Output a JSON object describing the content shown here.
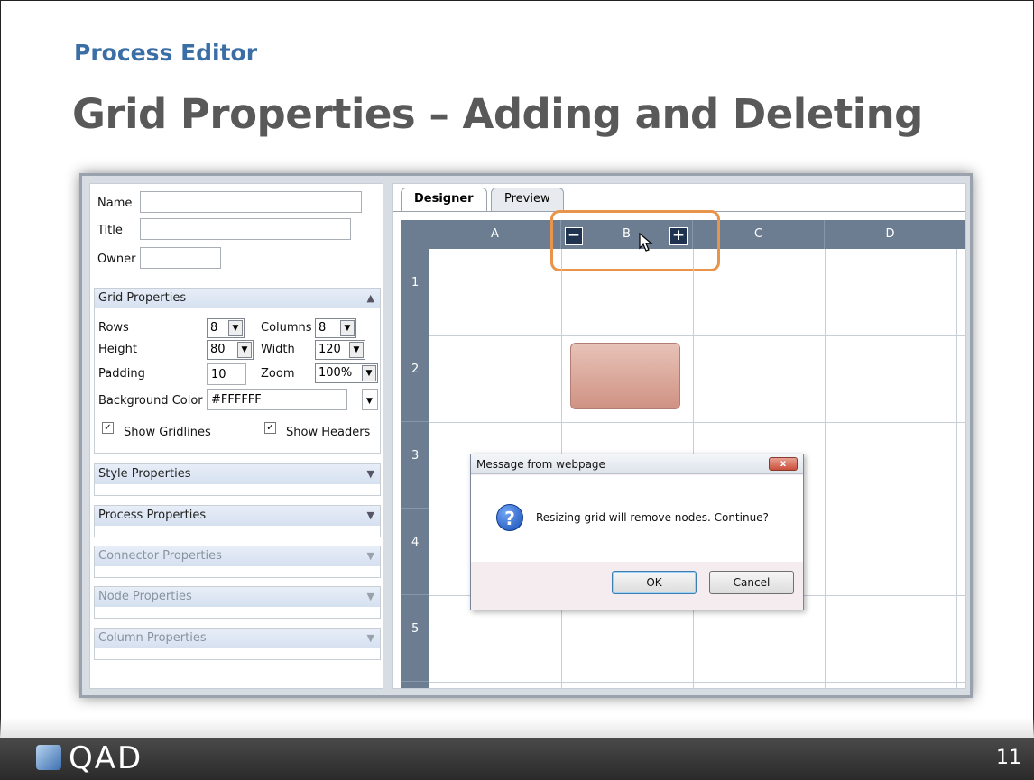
{
  "slide": {
    "subtitle": "Process Editor",
    "title": "Grid Properties – Adding and Deleting",
    "page_number": "11",
    "logo_text": "QAD"
  },
  "form": {
    "name_label": "Name",
    "title_label": "Title",
    "owner_label": "Owner",
    "name_value": "",
    "title_value": "",
    "owner_value": ""
  },
  "grid_properties": {
    "header": "Grid Properties",
    "rows_label": "Rows",
    "rows_value": "8",
    "columns_label": "Columns",
    "columns_value": "8",
    "height_label": "Height",
    "height_value": "80",
    "width_label": "Width",
    "width_value": "120",
    "padding_label": "Padding",
    "padding_value": "10",
    "zoom_label": "Zoom",
    "zoom_value": "100%",
    "bgcolor_label": "Background Color",
    "bgcolor_value": "#FFFFFF",
    "show_gridlines_label": "Show Gridlines",
    "show_gridlines_checked": true,
    "show_headers_label": "Show Headers",
    "show_headers_checked": true
  },
  "sections": {
    "style": "Style Properties",
    "process": "Process Properties",
    "connector": "Connector Properties",
    "node": "Node Properties",
    "column": "Column Properties"
  },
  "tabs": {
    "designer": "Designer",
    "preview": "Preview"
  },
  "grid": {
    "columns": [
      "A",
      "B",
      "C",
      "D"
    ],
    "rows": [
      "1",
      "2",
      "3",
      "4",
      "5"
    ],
    "remove_column_symbol": "−",
    "add_column_symbol": "+"
  },
  "dialog": {
    "title": "Message from webpage",
    "close_symbol": "x",
    "icon_symbol": "?",
    "message": "Resizing grid will remove nodes.  Continue?",
    "ok": "OK",
    "cancel": "Cancel"
  },
  "colors": {
    "title": "#595959",
    "subtitle": "#3a6ea5",
    "highlight": "#e8944a",
    "grid_header": "#6c7d91",
    "node_fill": "#d9a294"
  }
}
